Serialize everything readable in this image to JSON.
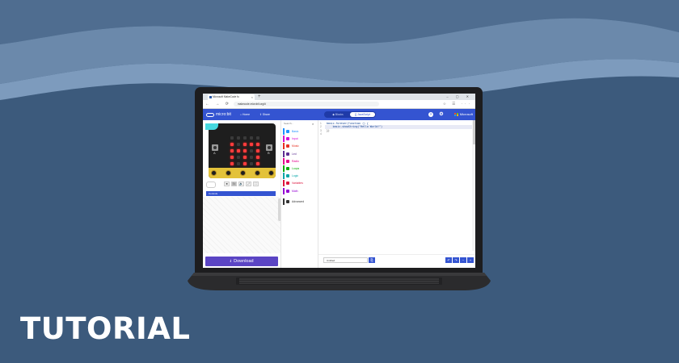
{
  "headline": "TUTORIAL",
  "browser": {
    "tab_title": "Microsoft MakeCode fo",
    "tab_close": "×",
    "new_tab": "+",
    "window_controls": "–  ▢  ✕",
    "nav": "← → ⟳ ⌂",
    "url": "makecode.microbit.org/#",
    "addr_icons": "☆ ☰ ···"
  },
  "header": {
    "logo_text": "micro:bit",
    "home_label": "⌂ Home",
    "share_label": "⇪ Share",
    "blocks_label": "◆ Blocks",
    "javascript_label": "{} JavaScript",
    "help_icon": "?",
    "settings_icon": "⚙",
    "brand": "Microsoft"
  },
  "simulator": {
    "led_matrix": [
      [
        0,
        0,
        0,
        0,
        0
      ],
      [
        1,
        0,
        1,
        1,
        1
      ],
      [
        1,
        1,
        1,
        0,
        1
      ],
      [
        1,
        0,
        1,
        0,
        1
      ],
      [
        1,
        0,
        1,
        0,
        1
      ]
    ],
    "button_a": "A",
    "button_b": "B",
    "pin_labels": [
      "0",
      "1",
      "2",
      "3V",
      "GND"
    ],
    "controls": [
      "■",
      "↻",
      "🔈",
      "⤢",
      "⛶"
    ],
    "pin_dropdown": "Controls",
    "download_label": "Download",
    "download_icon": "⭳"
  },
  "toolbox": {
    "search_placeholder": "Search...",
    "search_icon": "⌕",
    "categories": [
      {
        "label": "Basic",
        "color": "#1e90ff"
      },
      {
        "label": "Input",
        "color": "#d400d4"
      },
      {
        "label": "Music",
        "color": "#e63022"
      },
      {
        "label": "Led",
        "color": "#5c2d91"
      },
      {
        "label": "Radio",
        "color": "#e3008c"
      },
      {
        "label": "Loops",
        "color": "#00aa00"
      },
      {
        "label": "Logic",
        "color": "#00a4a6"
      },
      {
        "label": "Variables",
        "color": "#dc143c"
      },
      {
        "label": "Math",
        "color": "#9400d3"
      },
      {
        "label": "Advanced",
        "color": "#333333"
      }
    ]
  },
  "editor": {
    "line_numbers": [
      "1",
      "2",
      "3",
      "4"
    ],
    "lines": [
      "basic.forever(function () {",
      "    basic.showString(\"Hello World!\")",
      "})",
      ""
    ],
    "project_name": "Untitled",
    "save_icon": "⎘",
    "bottom_buttons": [
      "↶",
      "↷",
      "−",
      "+"
    ]
  }
}
